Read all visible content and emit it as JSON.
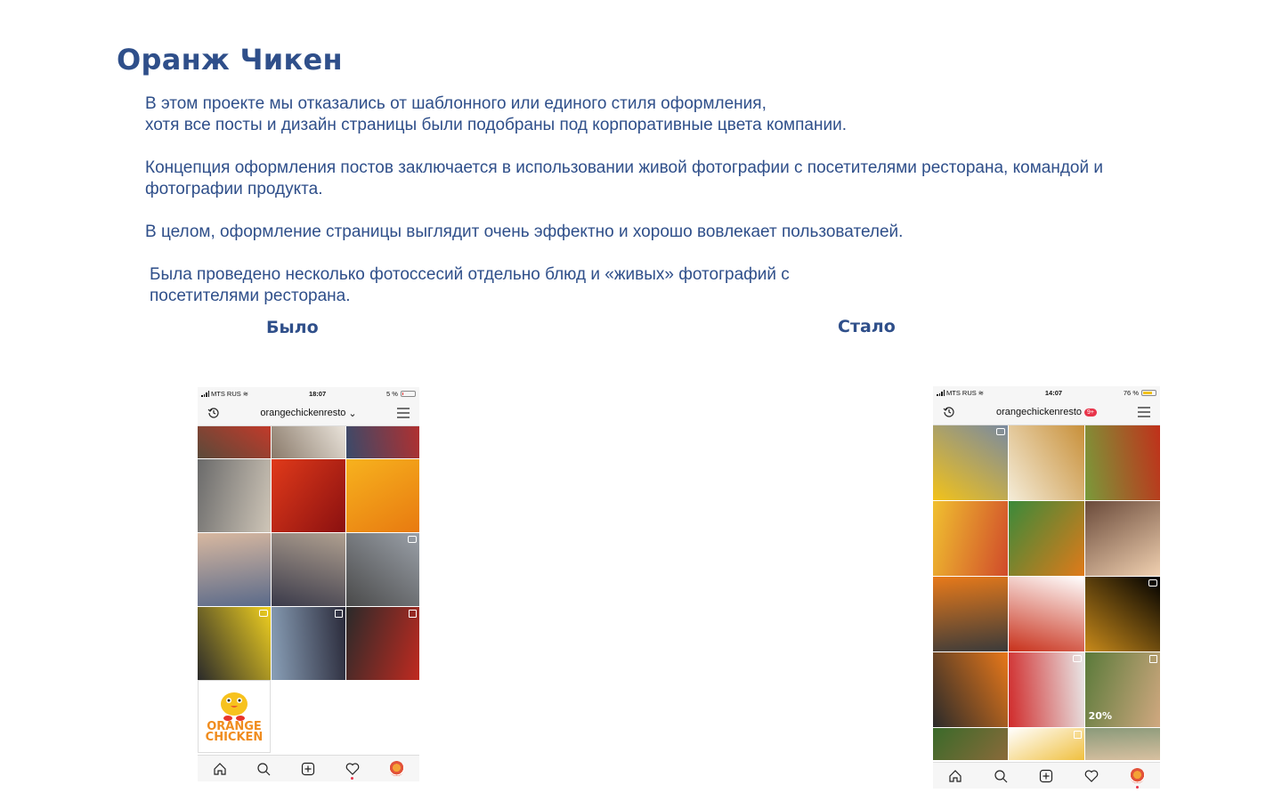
{
  "title": "Оранж Чикен",
  "paragraphs": {
    "p1_line1": "В этом проекте мы отказались от шаблонного или единого стиля оформления,",
    "p1_line2": "хотя все посты и дизайн страницы были подобраны под корпоративные цвета компании.",
    "p2": "Концепция оформления постов заключается в использовании живой фотографии с посетителями ресторана, командой и фотографии продукта.",
    "p3": "В целом, оформление страницы выглядит очень эффектно и хорошо вовлекает пользователей.",
    "p4_line1": "Была проведено несколько фотоссесий отдельно блюд и «живых» фотографий с",
    "p4_line2": "посетителями ресторана."
  },
  "labels": {
    "before": "Было",
    "after": "Стало"
  },
  "before_phone": {
    "carrier": "MTS RUS",
    "time": "18:07",
    "battery": "5 %",
    "battery_level": 0.05,
    "username": "orangechickenresto",
    "logo_line1": "ORANGE",
    "logo_line2": "CHICKEN",
    "tiles": [
      {
        "colors": [
          "#5a4a3a",
          "#c23a2a"
        ],
        "badge": ""
      },
      {
        "colors": [
          "#8a7a6a",
          "#e9e3da"
        ],
        "badge": ""
      },
      {
        "colors": [
          "#3a4a6a",
          "#b03030"
        ],
        "badge": ""
      },
      {
        "colors": [
          "#6a6a6a",
          "#cfc6b8"
        ],
        "badge": ""
      },
      {
        "colors": [
          "#e03a1a",
          "#8a1010"
        ],
        "badge": ""
      },
      {
        "colors": [
          "#f7b21e",
          "#e87a10"
        ],
        "badge": ""
      },
      {
        "colors": [
          "#d8b8a0",
          "#5a6a8a"
        ],
        "badge": ""
      },
      {
        "colors": [
          "#b0a090",
          "#3a3a4a"
        ],
        "badge": ""
      },
      {
        "colors": [
          "#9aa0a8",
          "#4a4a4a"
        ],
        "badge": "video"
      },
      {
        "colors": [
          "#f0d020",
          "#2a2a2a"
        ],
        "badge": "video"
      },
      {
        "colors": [
          "#2a2a3a",
          "#8aa0b8"
        ],
        "badge": "multi"
      },
      {
        "colors": [
          "#c02a20",
          "#2a2a2a"
        ],
        "badge": "multi"
      }
    ]
  },
  "after_phone": {
    "carrier": "MTS RUS",
    "time": "14:07",
    "battery": "76 %",
    "battery_level": 0.76,
    "username": "orangechickenresto",
    "notif_count": "9+",
    "tiles": [
      {
        "colors": [
          "#f2c21a",
          "#7a8aa0"
        ],
        "badge": "video"
      },
      {
        "colors": [
          "#f4ecd8",
          "#c8903a"
        ],
        "badge": ""
      },
      {
        "colors": [
          "#7a9a3a",
          "#c0301a"
        ],
        "badge": ""
      },
      {
        "colors": [
          "#f0c030",
          "#d04a2a"
        ],
        "badge": ""
      },
      {
        "colors": [
          "#3a8a3a",
          "#e07a1a"
        ],
        "badge": ""
      },
      {
        "colors": [
          "#6a4a3a",
          "#f0d0b0"
        ],
        "badge": ""
      },
      {
        "colors": [
          "#e87a1a",
          "#3a3a3a"
        ],
        "badge": ""
      },
      {
        "colors": [
          "#ffffff",
          "#c8301a"
        ],
        "badge": ""
      },
      {
        "colors": [
          "#000000",
          "#c88a1a"
        ],
        "badge": "video"
      },
      {
        "colors": [
          "#e8781a",
          "#2a2a2a"
        ],
        "badge": ""
      },
      {
        "colors": [
          "#e8e8e8",
          "#d02a2a"
        ],
        "badge": "video"
      },
      {
        "colors": [
          "#d0a880",
          "#5a7a3a"
        ],
        "badge": "multi"
      },
      {
        "colors": [
          "#8a6a3a",
          "#3a6a2a"
        ],
        "badge": ""
      },
      {
        "colors": [
          "#f0c040",
          "#ffffff"
        ],
        "badge": "multi"
      },
      {
        "colors": [
          "#d8c0a0",
          "#8a9a7a"
        ],
        "badge": ""
      }
    ],
    "promo_text": "20%"
  }
}
